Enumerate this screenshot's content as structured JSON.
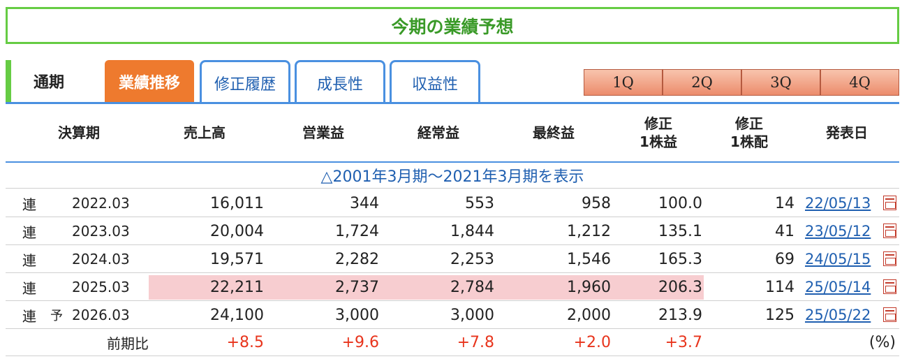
{
  "title": "今期の業績予想",
  "tabs": {
    "static": "通期",
    "active": "業績推移",
    "others": [
      "修正履歴",
      "成長性",
      "収益性"
    ]
  },
  "quarters": [
    "1Q",
    "2Q",
    "3Q",
    "4Q"
  ],
  "headers": {
    "period": "決算期",
    "sales": "売上高",
    "op": "営業益",
    "ord": "経常益",
    "net": "最終益",
    "eps_l1": "修正",
    "eps_l2": "1株益",
    "div_l1": "修正",
    "div_l2": "1株配",
    "date": "発表日"
  },
  "expand_link": "△2001年3月期～2021年3月期を表示",
  "rows": [
    {
      "type": "連",
      "forecast": "",
      "period": "2022.03",
      "sales": "16,011",
      "op": "344",
      "ord": "553",
      "net": "958",
      "eps": "100.0",
      "div": "14",
      "date": "22/05/13"
    },
    {
      "type": "連",
      "forecast": "",
      "period": "2023.03",
      "sales": "20,004",
      "op": "1,724",
      "ord": "1,844",
      "net": "1,212",
      "eps": "135.1",
      "div": "41",
      "date": "23/05/12"
    },
    {
      "type": "連",
      "forecast": "",
      "period": "2024.03",
      "sales": "19,571",
      "op": "2,282",
      "ord": "2,253",
      "net": "1,546",
      "eps": "165.3",
      "div": "69",
      "date": "24/05/15"
    },
    {
      "type": "連",
      "forecast": "",
      "period": "2025.03",
      "sales": "22,211",
      "op": "2,737",
      "ord": "2,784",
      "net": "1,960",
      "eps": "206.3",
      "div": "114",
      "date": "25/05/14"
    },
    {
      "type": "連",
      "forecast": "予",
      "period": "2026.03",
      "sales": "24,100",
      "op": "3,000",
      "ord": "3,000",
      "net": "2,000",
      "eps": "213.9",
      "div": "125",
      "date": "25/05/22"
    }
  ],
  "yoy": {
    "label": "前期比",
    "sales": "+8.5",
    "op": "+9.6",
    "ord": "+7.8",
    "net": "+2.0",
    "eps": "+3.7",
    "unit": "(%)"
  },
  "colors": {
    "title_green": "#3a9a28",
    "tab_orange": "#ee7a2e",
    "link_blue": "#1f5fb0",
    "highlight_pink": "#f7cdd0",
    "change_red": "#e8341c"
  }
}
